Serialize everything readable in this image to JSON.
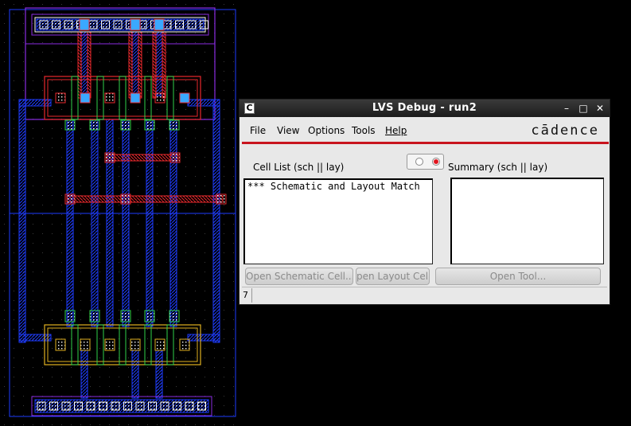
{
  "window": {
    "title": "LVS Debug - run2",
    "icon_glyph": "C",
    "controls": {
      "minimize": "–",
      "maximize": "□",
      "close": "✕"
    }
  },
  "menu": {
    "items": [
      "File",
      "View",
      "Options",
      "Tools",
      "Help"
    ]
  },
  "brand": "cādence",
  "cell_list": {
    "label": "Cell List (sch || lay)",
    "lines": [
      "*** Schematic and Layout Match"
    ]
  },
  "summary": {
    "label": "Summary (sch || lay)",
    "lines": []
  },
  "buttons": {
    "open_schematic": "Open Schematic Cell...",
    "open_layout": "pen Layout Cell",
    "open_tool": "Open Tool..."
  },
  "status": {
    "value": "7"
  },
  "colors": {
    "background": "#000000",
    "metal1_blue": "#1e3cff",
    "poly_red": "#e8282c",
    "contact_cyan": "#3aa8ff",
    "diff_green": "#2fd24a",
    "nwell_purple": "#8a2be2",
    "implant_orange": "#e0b020",
    "accent_red": "#c8141e"
  }
}
